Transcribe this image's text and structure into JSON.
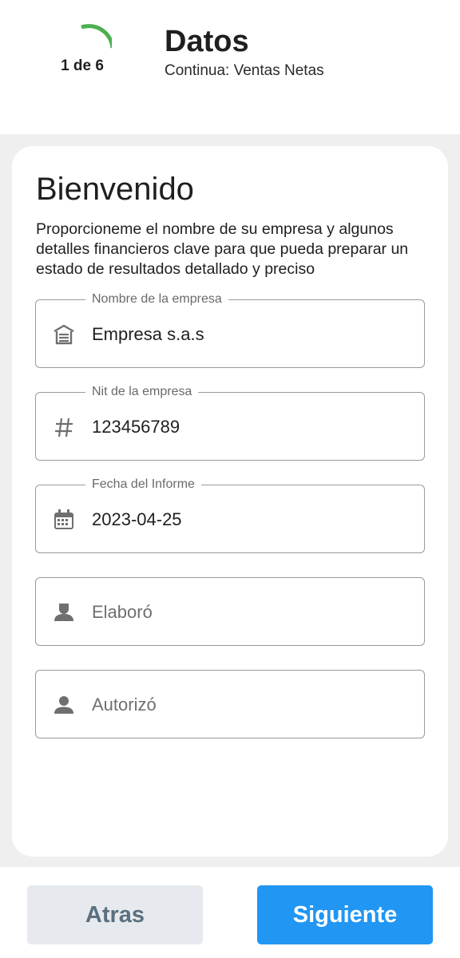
{
  "header": {
    "step_text": "1 de 6",
    "step_current": 1,
    "step_total": 6,
    "title": "Datos",
    "subtitle": "Continua: Ventas Netas",
    "progress_color": "#4caf50"
  },
  "card": {
    "heading": "Bienvenido",
    "intro": "Proporcioneme el nombre de su empresa y algunos detalles financieros clave para que pueda preparar un estado de resultados detallado y preciso"
  },
  "fields": [
    {
      "label": "Nombre de la empresa",
      "value": "Empresa s.a.s",
      "icon": "warehouse-icon"
    },
    {
      "label": "Nit de la empresa",
      "value": "123456789",
      "icon": "hash-icon"
    },
    {
      "label": "Fecha del Informe",
      "value": "2023-04-25",
      "icon": "calendar-icon"
    },
    {
      "label": "",
      "placeholder": "Elaboró",
      "value": "",
      "icon": "person-badge-icon"
    },
    {
      "label": "",
      "placeholder": "Autorizó",
      "value": "",
      "icon": "person-icon"
    }
  ],
  "footer": {
    "back_label": "Atras",
    "next_label": "Siguiente",
    "next_color": "#2196f3"
  }
}
